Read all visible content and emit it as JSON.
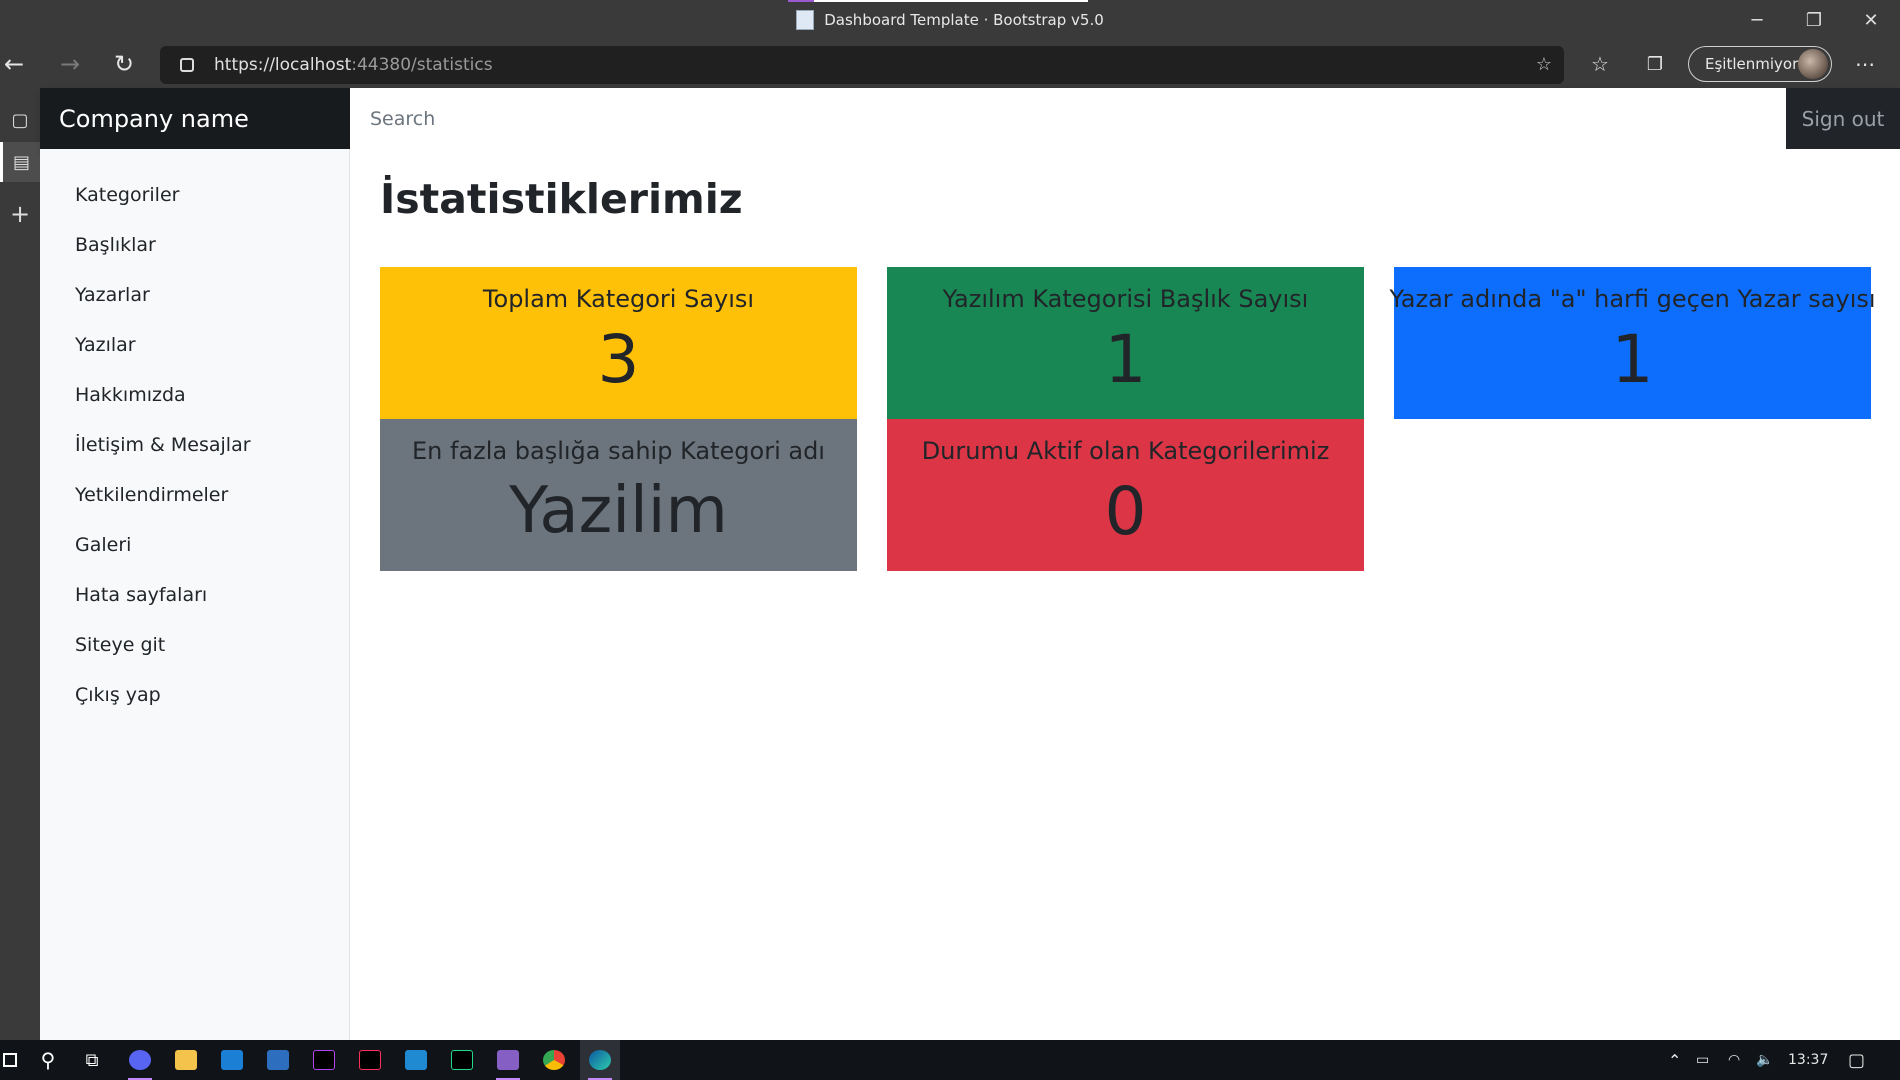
{
  "browser": {
    "tab_title": "Dashboard Template · Bootstrap v5.0",
    "url_host": "https://localhost",
    "url_rest": ":44380/statistics",
    "profile_label": "Eşitlenmiyor",
    "window_controls": {
      "minimize": "─",
      "restore": "❐",
      "close": "✕"
    }
  },
  "header": {
    "brand": "Company name",
    "search_placeholder": "Search",
    "signout": "Sign out"
  },
  "sidebar": {
    "items": [
      {
        "label": "Kategoriler"
      },
      {
        "label": "Başlıklar"
      },
      {
        "label": "Yazarlar"
      },
      {
        "label": "Yazılar"
      },
      {
        "label": "Hakkımızda"
      },
      {
        "label": "İletişim & Mesajlar"
      },
      {
        "label": "Yetkilendirmeler"
      },
      {
        "label": "Galeri"
      },
      {
        "label": "Hata sayfaları"
      },
      {
        "label": "Siteye git"
      },
      {
        "label": "Çıkış yap"
      }
    ]
  },
  "main": {
    "title": "İstatistiklerimiz",
    "cards": [
      {
        "title": "Toplam Kategori Sayısı",
        "value": "3",
        "color": "#ffc107"
      },
      {
        "title": "Yazılım Kategorisi Başlık Sayısı",
        "value": "1",
        "color": "#198754"
      },
      {
        "title": "Yazar adında \"a\" harfi geçen Yazar sayısı",
        "value": "1",
        "color": "#0d6efd"
      },
      {
        "title": "En fazla başlığa sahip Kategori adı",
        "value": "Yazilim",
        "color": "#6c757d"
      },
      {
        "title": "Durumu Aktif olan Kategorilerimiz",
        "value": "0",
        "color": "#dc3545"
      }
    ]
  },
  "taskbar": {
    "time": "13:37",
    "apps": [
      "discord-icon",
      "file-explorer-icon",
      "mail-icon",
      "camera-icon",
      "phpstorm-icon",
      "intellij-icon",
      "vscode-icon",
      "webstorm-icon",
      "visual-studio-icon",
      "chrome-icon",
      "edge-icon"
    ]
  }
}
